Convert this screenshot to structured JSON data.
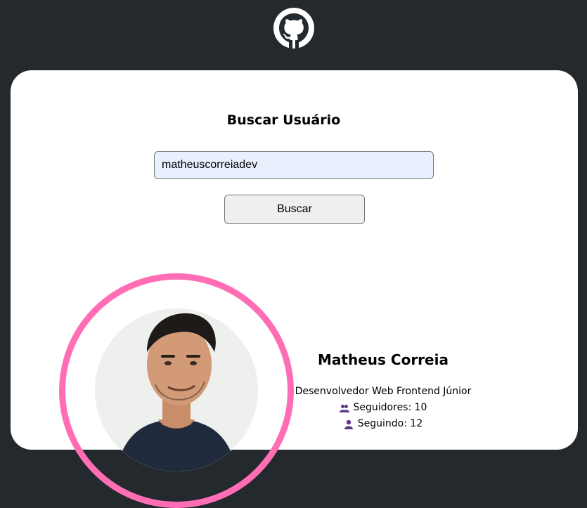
{
  "header": {
    "logo_icon": "github-icon"
  },
  "search": {
    "title": "Buscar Usuário",
    "input_value": "matheuscorreiadev",
    "button_label": "Buscar"
  },
  "profile": {
    "name": "Matheus Correia",
    "bio": "Desenvolvedor Web Frontend Júnior",
    "followers_label": "Seguidores: 10",
    "following_label": "Seguindo: 12",
    "followers_icon": "users-icon",
    "following_icon": "user-icon"
  },
  "colors": {
    "header_bg": "#24292e",
    "card_bg": "#ffffff",
    "ring": "#ff6eb4",
    "input_bg": "#e8f0fe",
    "icon_accent": "#5b3a86"
  }
}
